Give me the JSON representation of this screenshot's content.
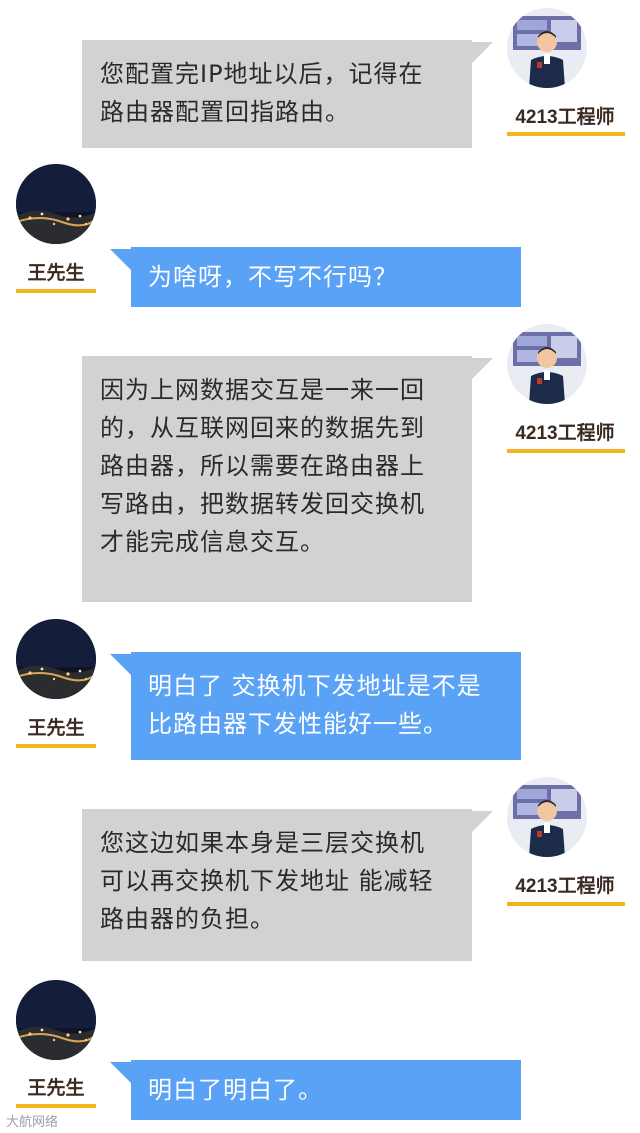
{
  "engineer": {
    "name": "4213工程师"
  },
  "customer": {
    "name": "王先生"
  },
  "messages": [
    {
      "sender": "engineer",
      "lines": [
        "您配置完IP地址以后，记得在",
        "路由器配置回指路由。"
      ]
    },
    {
      "sender": "customer",
      "lines": [
        "为啥呀，不写不行吗？"
      ]
    },
    {
      "sender": "engineer",
      "lines": [
        "因为上网数据交互是一来一回",
        "的，从互联网回来的数据先到",
        "路由器，所以需要在路由器上",
        "写路由，把数据转发回交换机",
        "才能完成信息交互。"
      ]
    },
    {
      "sender": "customer",
      "lines": [
        "明白了 交换机下发地址是不是",
        "比路由器下发性能好一些。"
      ]
    },
    {
      "sender": "engineer",
      "lines": [
        "您这边如果本身是三层交换机",
        "可以再交换机下发地址 能减轻",
        "路由器的负担。"
      ]
    },
    {
      "sender": "customer",
      "lines": [
        "明白了明白了。"
      ]
    }
  ],
  "watermark": "大航网络",
  "colors": {
    "engineer_bubble": "#d2d2d2",
    "customer_bubble": "#5aa2f6",
    "name_underline": "#f3b51c"
  }
}
